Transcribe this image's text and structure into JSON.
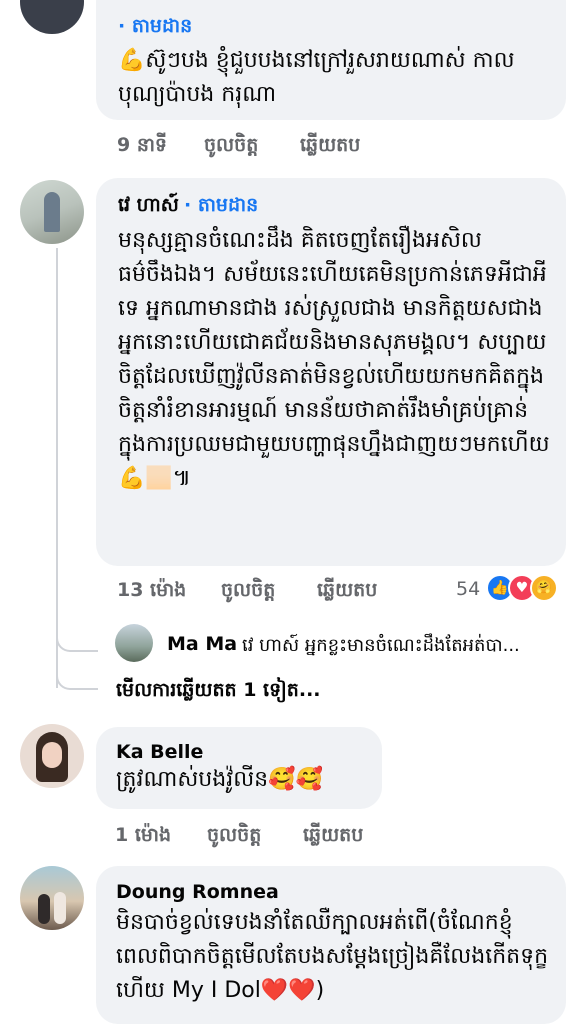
{
  "comments": [
    {
      "author": "",
      "follow_label": "· តាមដាន",
      "text": "💪ស៊ូៗបង ខ្ញុំជួបបងនៅក្រៅរួសរាយណាស់ កាលបុណ្យប៉ាបង ករុណា",
      "time": "9 នាទី",
      "like_label": "ចូលចិត្ត",
      "reply_label": "ឆ្លើយតប"
    },
    {
      "author": "វេ ហាស៍",
      "follow_label": "· តាមដាន",
      "text": "មនុស្សគ្មានចំណេះដឹង គិតចេញតែរឿងអសិលធម៌ចឹងឯង។ សម័យនេះហើយគេមិនប្រកាន់ភេទអីជាអីទេ អ្នកណាមានជាង រស់ស្រួលជាង មានកិត្តយសជាង អ្នកនោះហើយជោគជ័យនិងមានសុភមង្គល។ សប្បាយចិត្តដែលឃើញវ៉ូលីនគាត់មិនខ្វល់ហើយយកមកគិតក្នុងចិត្តនាំរំខានអារម្មណ៍ មានន័យថាគាត់រឹងមាំគ្រប់គ្រាន់ក្នុងការប្រឈមជាមួយបញ្ហាផុនហ្នឹងជាញយៗមកហើយ💪🏻៕",
      "time": "13 ម៉ោង",
      "like_label": "ចូលចិត្ត",
      "reply_label": "ឆ្លើយតប",
      "reaction_count": "54",
      "reply_preview_author": "Ma Ma",
      "reply_preview_text": "វេ ហាស៍ អ្នកខ្លះមានចំណេះដឹងតែអត់បា...",
      "more_replies": "មើលការឆ្លើយតត 1 ទៀត..."
    },
    {
      "author": "Ka Belle",
      "text": "ត្រូវណាស់បងវ៉ូលីន🥰🥰",
      "time": "1 ម៉ោង",
      "like_label": "ចូលចិត្ត",
      "reply_label": "ឆ្លើយតប"
    },
    {
      "author": "Doung Romnea",
      "text": "មិនបាច់ខ្វល់ទេបងនាំតែឈឺក្បាលអត់ពើ(ចំណែកខ្ញុំពេលពិបាកចិត្តមើលតែបងសម្ដែងច្រៀងគឺលែងកើតទុក្ខហើយ My I Dol❤️❤️)"
    }
  ],
  "reactions": {
    "like_icon": "like-icon",
    "love_icon": "love-icon",
    "care_icon": "care-icon"
  },
  "colors": {
    "bubble": "#f0f2f5",
    "link": "#1877f2",
    "meta": "#65676b"
  }
}
